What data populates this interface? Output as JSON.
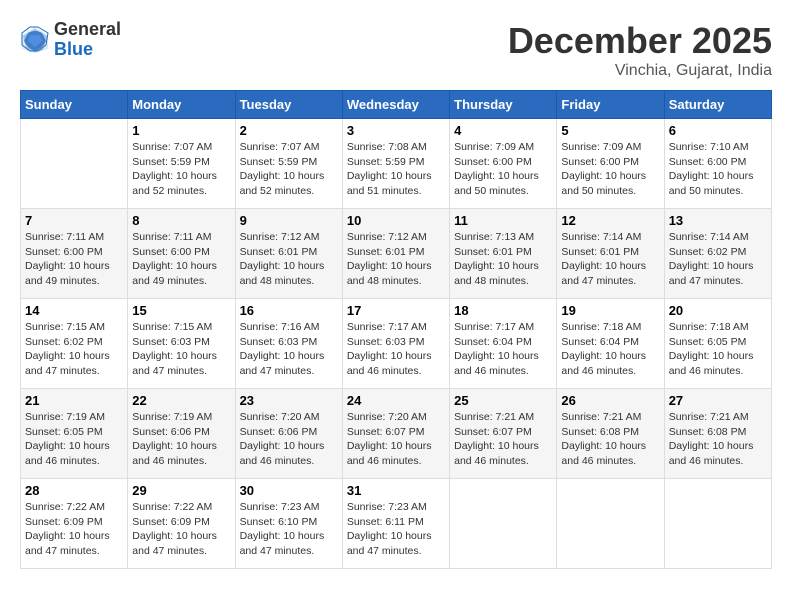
{
  "header": {
    "logo_general": "General",
    "logo_blue": "Blue",
    "title": "December 2025",
    "subtitle": "Vinchia, Gujarat, India"
  },
  "weekdays": [
    "Sunday",
    "Monday",
    "Tuesday",
    "Wednesday",
    "Thursday",
    "Friday",
    "Saturday"
  ],
  "weeks": [
    [
      {
        "day": "",
        "info": ""
      },
      {
        "day": "1",
        "info": "Sunrise: 7:07 AM\nSunset: 5:59 PM\nDaylight: 10 hours\nand 52 minutes."
      },
      {
        "day": "2",
        "info": "Sunrise: 7:07 AM\nSunset: 5:59 PM\nDaylight: 10 hours\nand 52 minutes."
      },
      {
        "day": "3",
        "info": "Sunrise: 7:08 AM\nSunset: 5:59 PM\nDaylight: 10 hours\nand 51 minutes."
      },
      {
        "day": "4",
        "info": "Sunrise: 7:09 AM\nSunset: 6:00 PM\nDaylight: 10 hours\nand 50 minutes."
      },
      {
        "day": "5",
        "info": "Sunrise: 7:09 AM\nSunset: 6:00 PM\nDaylight: 10 hours\nand 50 minutes."
      },
      {
        "day": "6",
        "info": "Sunrise: 7:10 AM\nSunset: 6:00 PM\nDaylight: 10 hours\nand 50 minutes."
      }
    ],
    [
      {
        "day": "7",
        "info": "Sunrise: 7:11 AM\nSunset: 6:00 PM\nDaylight: 10 hours\nand 49 minutes."
      },
      {
        "day": "8",
        "info": "Sunrise: 7:11 AM\nSunset: 6:00 PM\nDaylight: 10 hours\nand 49 minutes."
      },
      {
        "day": "9",
        "info": "Sunrise: 7:12 AM\nSunset: 6:01 PM\nDaylight: 10 hours\nand 48 minutes."
      },
      {
        "day": "10",
        "info": "Sunrise: 7:12 AM\nSunset: 6:01 PM\nDaylight: 10 hours\nand 48 minutes."
      },
      {
        "day": "11",
        "info": "Sunrise: 7:13 AM\nSunset: 6:01 PM\nDaylight: 10 hours\nand 48 minutes."
      },
      {
        "day": "12",
        "info": "Sunrise: 7:14 AM\nSunset: 6:01 PM\nDaylight: 10 hours\nand 47 minutes."
      },
      {
        "day": "13",
        "info": "Sunrise: 7:14 AM\nSunset: 6:02 PM\nDaylight: 10 hours\nand 47 minutes."
      }
    ],
    [
      {
        "day": "14",
        "info": "Sunrise: 7:15 AM\nSunset: 6:02 PM\nDaylight: 10 hours\nand 47 minutes."
      },
      {
        "day": "15",
        "info": "Sunrise: 7:15 AM\nSunset: 6:03 PM\nDaylight: 10 hours\nand 47 minutes."
      },
      {
        "day": "16",
        "info": "Sunrise: 7:16 AM\nSunset: 6:03 PM\nDaylight: 10 hours\nand 47 minutes."
      },
      {
        "day": "17",
        "info": "Sunrise: 7:17 AM\nSunset: 6:03 PM\nDaylight: 10 hours\nand 46 minutes."
      },
      {
        "day": "18",
        "info": "Sunrise: 7:17 AM\nSunset: 6:04 PM\nDaylight: 10 hours\nand 46 minutes."
      },
      {
        "day": "19",
        "info": "Sunrise: 7:18 AM\nSunset: 6:04 PM\nDaylight: 10 hours\nand 46 minutes."
      },
      {
        "day": "20",
        "info": "Sunrise: 7:18 AM\nSunset: 6:05 PM\nDaylight: 10 hours\nand 46 minutes."
      }
    ],
    [
      {
        "day": "21",
        "info": "Sunrise: 7:19 AM\nSunset: 6:05 PM\nDaylight: 10 hours\nand 46 minutes."
      },
      {
        "day": "22",
        "info": "Sunrise: 7:19 AM\nSunset: 6:06 PM\nDaylight: 10 hours\nand 46 minutes."
      },
      {
        "day": "23",
        "info": "Sunrise: 7:20 AM\nSunset: 6:06 PM\nDaylight: 10 hours\nand 46 minutes."
      },
      {
        "day": "24",
        "info": "Sunrise: 7:20 AM\nSunset: 6:07 PM\nDaylight: 10 hours\nand 46 minutes."
      },
      {
        "day": "25",
        "info": "Sunrise: 7:21 AM\nSunset: 6:07 PM\nDaylight: 10 hours\nand 46 minutes."
      },
      {
        "day": "26",
        "info": "Sunrise: 7:21 AM\nSunset: 6:08 PM\nDaylight: 10 hours\nand 46 minutes."
      },
      {
        "day": "27",
        "info": "Sunrise: 7:21 AM\nSunset: 6:08 PM\nDaylight: 10 hours\nand 46 minutes."
      }
    ],
    [
      {
        "day": "28",
        "info": "Sunrise: 7:22 AM\nSunset: 6:09 PM\nDaylight: 10 hours\nand 47 minutes."
      },
      {
        "day": "29",
        "info": "Sunrise: 7:22 AM\nSunset: 6:09 PM\nDaylight: 10 hours\nand 47 minutes."
      },
      {
        "day": "30",
        "info": "Sunrise: 7:23 AM\nSunset: 6:10 PM\nDaylight: 10 hours\nand 47 minutes."
      },
      {
        "day": "31",
        "info": "Sunrise: 7:23 AM\nSunset: 6:11 PM\nDaylight: 10 hours\nand 47 minutes."
      },
      {
        "day": "",
        "info": ""
      },
      {
        "day": "",
        "info": ""
      },
      {
        "day": "",
        "info": ""
      }
    ]
  ]
}
